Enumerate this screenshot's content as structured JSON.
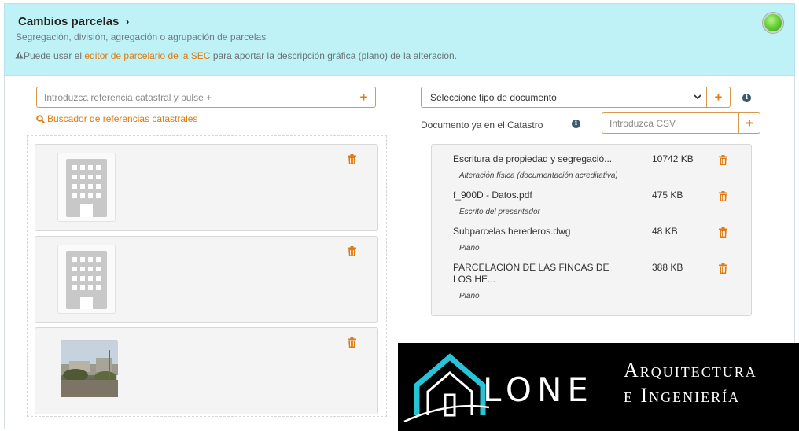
{
  "header": {
    "title": "Cambios parcelas",
    "subtitle": "Segregación, división, agregación o agrupación de parcelas",
    "notice_prefix": "Puede usar el ",
    "notice_link": "editor de parcelario de la SEC",
    "notice_suffix": " para aportar la descripción gráfica (plano) de la alteración.",
    "status_color": "#5ccf2f"
  },
  "left": {
    "ref_placeholder": "Introduzca referencia catastral y pulse +",
    "add_label": "+",
    "finder_label": "Buscador de referencias catastrales",
    "parcels": [
      {
        "image": "building-placeholder-icon"
      },
      {
        "image": "building-placeholder-icon"
      },
      {
        "image": "parcel-photo"
      }
    ]
  },
  "right": {
    "doc_type_selected": "Seleccione tipo de documento",
    "add_label": "+",
    "catastro_label": "Documento ya en el Catastro",
    "csv_placeholder": "Introduzca CSV",
    "documents": [
      {
        "name": "Escritura de propiedad y segregació...",
        "size": "10742 KB",
        "desc": "Alteración física (documentación acreditativa)"
      },
      {
        "name": "f_900D - Datos.pdf",
        "size": "475 KB",
        "desc": "Escrito del presentador"
      },
      {
        "name": "Subparcelas herederos.dwg",
        "size": "48 KB",
        "desc": "Plano"
      },
      {
        "name": "PARCELACIÓN DE LAS FINCAS DE LOS HE...",
        "size": "388 KB",
        "desc": "Plano"
      }
    ]
  },
  "brand": {
    "name": "LONE",
    "line1": "Arquitectura",
    "line2": "e Ingeniería"
  },
  "colors": {
    "accent": "#e07b12",
    "header_bg": "#bff2f7",
    "logo_cyan": "#27c3d6"
  }
}
